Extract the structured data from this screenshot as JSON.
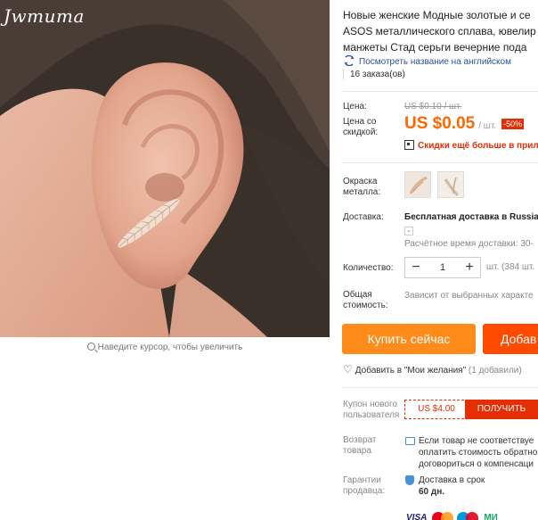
{
  "gallery": {
    "brand_watermark": "Jwmuma",
    "zoom_hint": "Наведите курсор, чтобы увеличить"
  },
  "product": {
    "title_lines": [
      "Новые женские Модные золотые и се",
      "ASOS металлического сплава, ювелир",
      "манжеты Стад серьги вечерние пода"
    ],
    "translate_link": "Посмотреть название на английском",
    "orders": "16 заказа(ов)"
  },
  "price": {
    "label": "Цена:",
    "old_value": "US $0.10 / шт.",
    "discount_label_line1": "Цена со",
    "discount_label_line2": "скидкой:",
    "new_value": "US $0.05",
    "unit": "/ шт.",
    "discount_badge": "-50%",
    "app_promo": "Скидки ещё больше в прило"
  },
  "options": {
    "metal_color_label_line1": "Окраска",
    "metal_color_label_line2": "металла:"
  },
  "shipping": {
    "label": "Доставка:",
    "method": "Бесплатная доставка в Russia",
    "estimate": "Расчётное время доставки: 30-"
  },
  "quantity": {
    "label": "Количество:",
    "value": "1",
    "minus": "−",
    "plus": "+",
    "available": "шт. (384 шт."
  },
  "total": {
    "label_line1": "Общая",
    "label_line2": "стоимость:",
    "value": "Зависит от выбранных характе"
  },
  "actions": {
    "buy_now": "Купить сейчас",
    "add_to_cart": "Добав"
  },
  "wishlist": {
    "label": "Добавить в \"Мои желания\"",
    "count": "(1 добавили)"
  },
  "coupon": {
    "label_line1": "Купон нового",
    "label_line2": "пользователя",
    "value": "US $4.00",
    "button": "ПОЛУЧИТЬ"
  },
  "returns": {
    "label_line1": "Возврат",
    "label_line2": "товара",
    "text_lines": [
      "Если товар не соответствуе",
      "оплатить стоимость обратно",
      "договориться о компенсаци"
    ]
  },
  "guarantee": {
    "label_line1": "Гарантии",
    "label_line2": "продавца:",
    "text_line1": "Доставка в срок",
    "text_line2": "60 дн."
  },
  "payment": {
    "visa": "VISA",
    "extra": "МИ"
  },
  "colors": {
    "price_orange": "#ff6600",
    "buy_button": "#ff8b1a",
    "cart_button": "#ff4a00",
    "discount_red": "#e62e04",
    "link_blue": "#2e4f9e"
  }
}
